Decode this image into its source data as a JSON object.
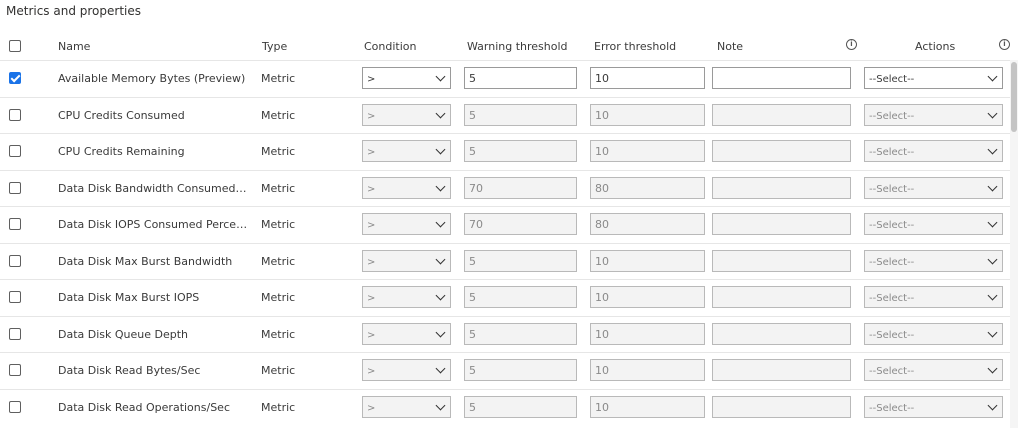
{
  "section": {
    "title": "Metrics and properties"
  },
  "headers": {
    "name": "Name",
    "type": "Type",
    "condition": "Condition",
    "warning": "Warning threshold",
    "error": "Error threshold",
    "note": "Note",
    "actions": "Actions"
  },
  "colors": {
    "accent": "#1a73e8",
    "border": "#b9b9b9",
    "disabled_bg": "#f3f3f3"
  },
  "rows": [
    {
      "checked": true,
      "name": "Available Memory Bytes (Preview)",
      "type": "Metric",
      "condition": ">",
      "warning": "5",
      "error": "10",
      "note": "",
      "actions": "--Select--"
    },
    {
      "checked": false,
      "name": "CPU Credits Consumed",
      "type": "Metric",
      "condition": ">",
      "warning": "5",
      "error": "10",
      "note": "",
      "actions": "--Select--"
    },
    {
      "checked": false,
      "name": "CPU Credits Remaining",
      "type": "Metric",
      "condition": ">",
      "warning": "5",
      "error": "10",
      "note": "",
      "actions": "--Select--"
    },
    {
      "checked": false,
      "name": "Data Disk Bandwidth Consumed Pe...",
      "type": "Metric",
      "condition": ">",
      "warning": "70",
      "error": "80",
      "note": "",
      "actions": "--Select--"
    },
    {
      "checked": false,
      "name": "Data Disk IOPS Consumed Percent...",
      "type": "Metric",
      "condition": ">",
      "warning": "70",
      "error": "80",
      "note": "",
      "actions": "--Select--"
    },
    {
      "checked": false,
      "name": "Data Disk Max Burst Bandwidth",
      "type": "Metric",
      "condition": ">",
      "warning": "5",
      "error": "10",
      "note": "",
      "actions": "--Select--"
    },
    {
      "checked": false,
      "name": "Data Disk Max Burst IOPS",
      "type": "Metric",
      "condition": ">",
      "warning": "5",
      "error": "10",
      "note": "",
      "actions": "--Select--"
    },
    {
      "checked": false,
      "name": "Data Disk Queue Depth",
      "type": "Metric",
      "condition": ">",
      "warning": "5",
      "error": "10",
      "note": "",
      "actions": "--Select--"
    },
    {
      "checked": false,
      "name": "Data Disk Read Bytes/Sec",
      "type": "Metric",
      "condition": ">",
      "warning": "5",
      "error": "10",
      "note": "",
      "actions": "--Select--"
    },
    {
      "checked": false,
      "name": "Data Disk Read Operations/Sec",
      "type": "Metric",
      "condition": ">",
      "warning": "5",
      "error": "10",
      "note": "",
      "actions": "--Select--"
    }
  ]
}
